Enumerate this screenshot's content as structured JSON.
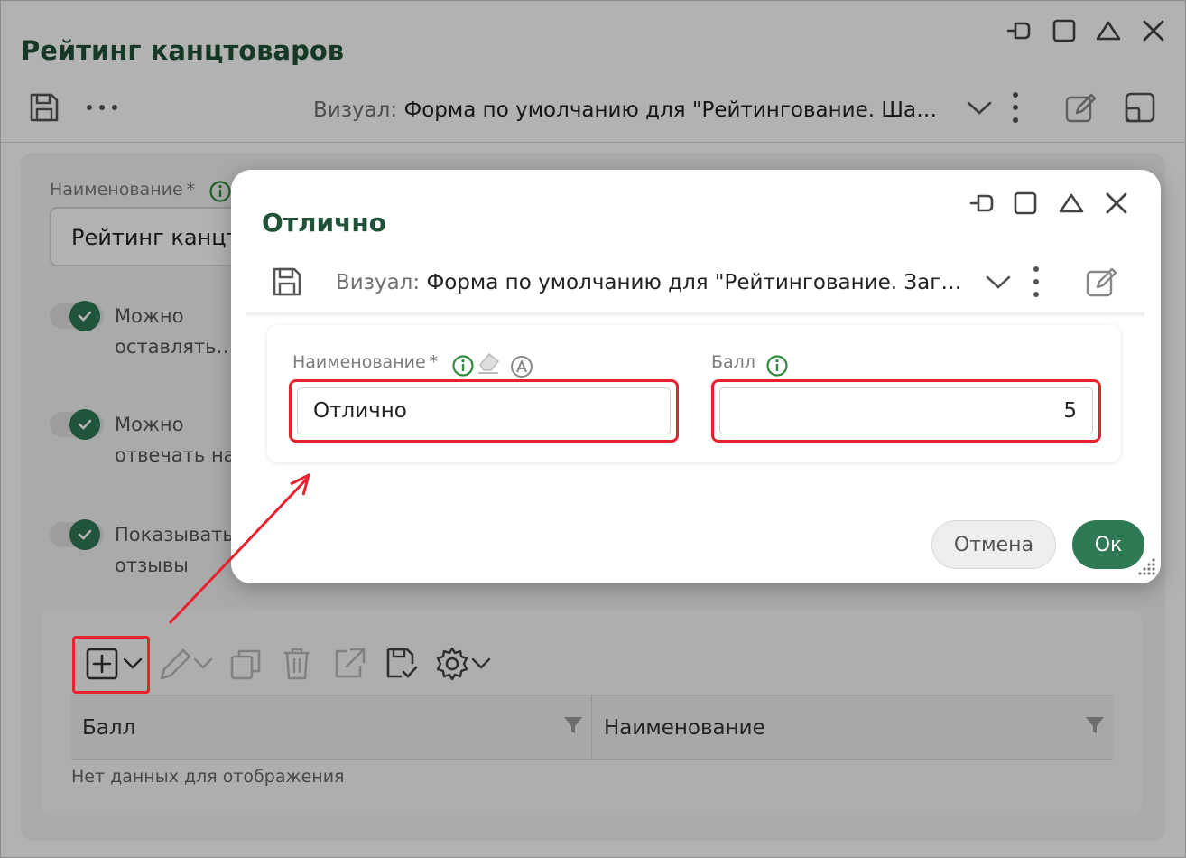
{
  "window": {
    "title": "Рейтинг канцтоваров",
    "visual_key": "Визуал:",
    "visual_value": "Форма по умолчанию для \"Рейтингование. Ша…"
  },
  "form": {
    "name_label": "Наименование",
    "required_mark": "*",
    "name_value": "Рейтинг канцтоваров",
    "toggles": [
      {
        "line1": "Можно",
        "line2": "оставлять…",
        "checked": true
      },
      {
        "line1": "Можно",
        "line2": "отвечать на…",
        "checked": true
      },
      {
        "line1": "Показывать",
        "line2": "отзывы",
        "checked": true
      }
    ]
  },
  "grid": {
    "columns": [
      "Балл",
      "Наименование"
    ],
    "empty_text": "Нет данных для отображения"
  },
  "dialog": {
    "title": "Отлично",
    "visual_key": "Визуал:",
    "visual_value": "Форма по умолчанию для \"Рейтингование. Заг…",
    "name_label": "Наименование",
    "required_mark": "*",
    "name_value": "Отлично",
    "score_label": "Балл",
    "score_value": "5",
    "cancel_label": "Отмена",
    "ok_label": "Ок"
  },
  "colors": {
    "brand_green": "#2f7a55",
    "title_green": "#1f5236",
    "highlight_red": "#e8212f"
  }
}
